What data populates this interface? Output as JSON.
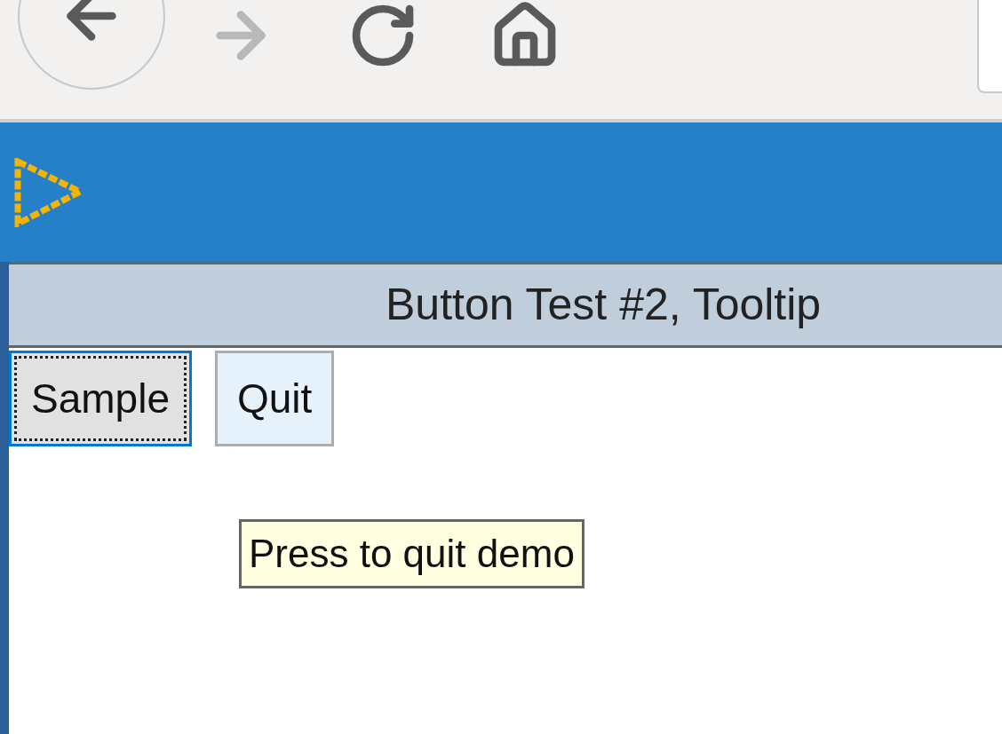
{
  "toolbar": {
    "buttons": [
      {
        "kind": "back",
        "disabled": false
      },
      {
        "kind": "forward",
        "disabled": true
      },
      {
        "kind": "reload",
        "disabled": false
      },
      {
        "kind": "home",
        "disabled": false
      }
    ]
  },
  "frame": {
    "title": "Button Test #2, Tooltip",
    "buttons": [
      {
        "label": "Sample",
        "focused": true,
        "hovered": false
      },
      {
        "label": "Quit",
        "focused": false,
        "hovered": true
      }
    ],
    "tooltip": "Press to quit demo"
  }
}
